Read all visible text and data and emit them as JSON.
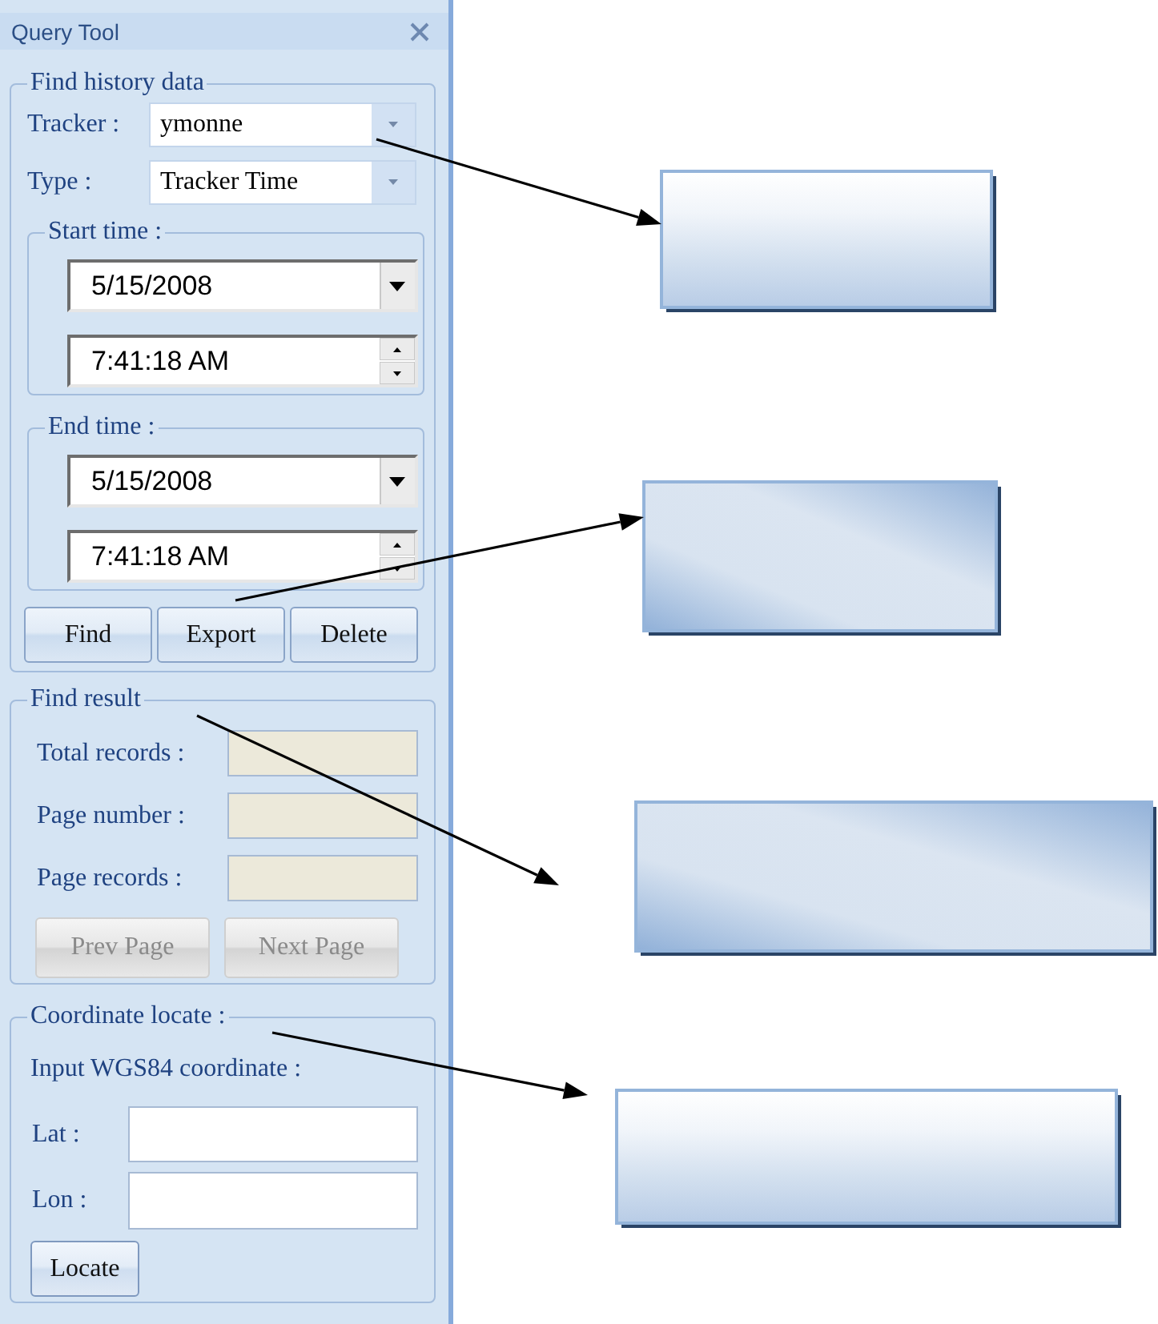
{
  "window": {
    "title": "Query Tool"
  },
  "find_history_data": {
    "legend": "Find history data",
    "tracker": {
      "label": "Tracker :",
      "value": "ymonne"
    },
    "type": {
      "label": "Type :",
      "value": "Tracker Time"
    },
    "start_time": {
      "legend": "Start time :",
      "date": "5/15/2008",
      "time": "7:41:18 AM"
    },
    "end_time": {
      "legend": "End time :",
      "date": "5/15/2008",
      "time": "7:41:18 AM"
    },
    "buttons": [
      {
        "label": "Find"
      },
      {
        "label": "Export"
      },
      {
        "label": "Delete"
      }
    ]
  },
  "find_result": {
    "legend": "Find result",
    "fields": [
      {
        "label": "Total records :",
        "readonly": true
      },
      {
        "label": "Page number :",
        "readonly": true
      },
      {
        "label": "Page records :",
        "readonly": true
      }
    ],
    "buttons": [
      {
        "label": "Prev Page",
        "disabled": true
      },
      {
        "label": "Next Page",
        "disabled": true
      }
    ]
  },
  "coordinate_locate": {
    "legend": "Coordinate locate :",
    "instruction": "Input WGS84 coordinate :",
    "fields": [
      {
        "label": "Lat :"
      },
      {
        "label": "Lon :"
      }
    ],
    "button": {
      "label": "Locate"
    }
  },
  "callouts": [
    {
      "kind": "fade"
    },
    {
      "kind": "sheen"
    },
    {
      "kind": "sheen"
    },
    {
      "kind": "fade"
    }
  ]
}
